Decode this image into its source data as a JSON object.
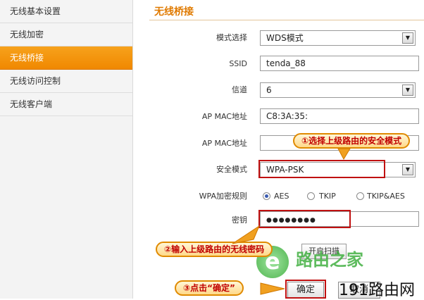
{
  "sidebar": {
    "items": [
      {
        "label": "无线基本设置"
      },
      {
        "label": "无线加密"
      },
      {
        "label": "无线桥接"
      },
      {
        "label": "无线访问控制"
      },
      {
        "label": "无线客户端"
      }
    ],
    "active_index": 2
  },
  "main": {
    "title": "无线桥接",
    "mode": {
      "label": "模式选择",
      "value": "WDS模式"
    },
    "ssid": {
      "label": "SSID",
      "value": "tenda_88"
    },
    "channel": {
      "label": "信道",
      "value": "6"
    },
    "mac1": {
      "label": "AP MAC地址",
      "value": "C8:3A:35:"
    },
    "mac2": {
      "label": "AP MAC地址",
      "value": ""
    },
    "security": {
      "label": "安全模式",
      "value": "WPA-PSK"
    },
    "wpa_rule": {
      "label": "WPA加密规则",
      "options": [
        "AES",
        "TKIP",
        "TKIP&AES"
      ],
      "selected": "AES"
    },
    "key": {
      "label": "密钥",
      "value": "●●●●●●●●"
    },
    "scan_button": "开启扫描",
    "ok_button": "确定",
    "cancel_button": "取消"
  },
  "callouts": {
    "c1": "①选择上级路由的安全模式",
    "c2": "②输入上级路由的无线密码",
    "c3": "③点击“确定”"
  },
  "watermark": {
    "brand": "路由之家",
    "site": "191路由网"
  },
  "colors": {
    "active_tab": "#f39400",
    "title": "#e07a00",
    "callout_text": "#c00000",
    "highlight_border": "#c01010",
    "callout_border": "#e08a00"
  }
}
